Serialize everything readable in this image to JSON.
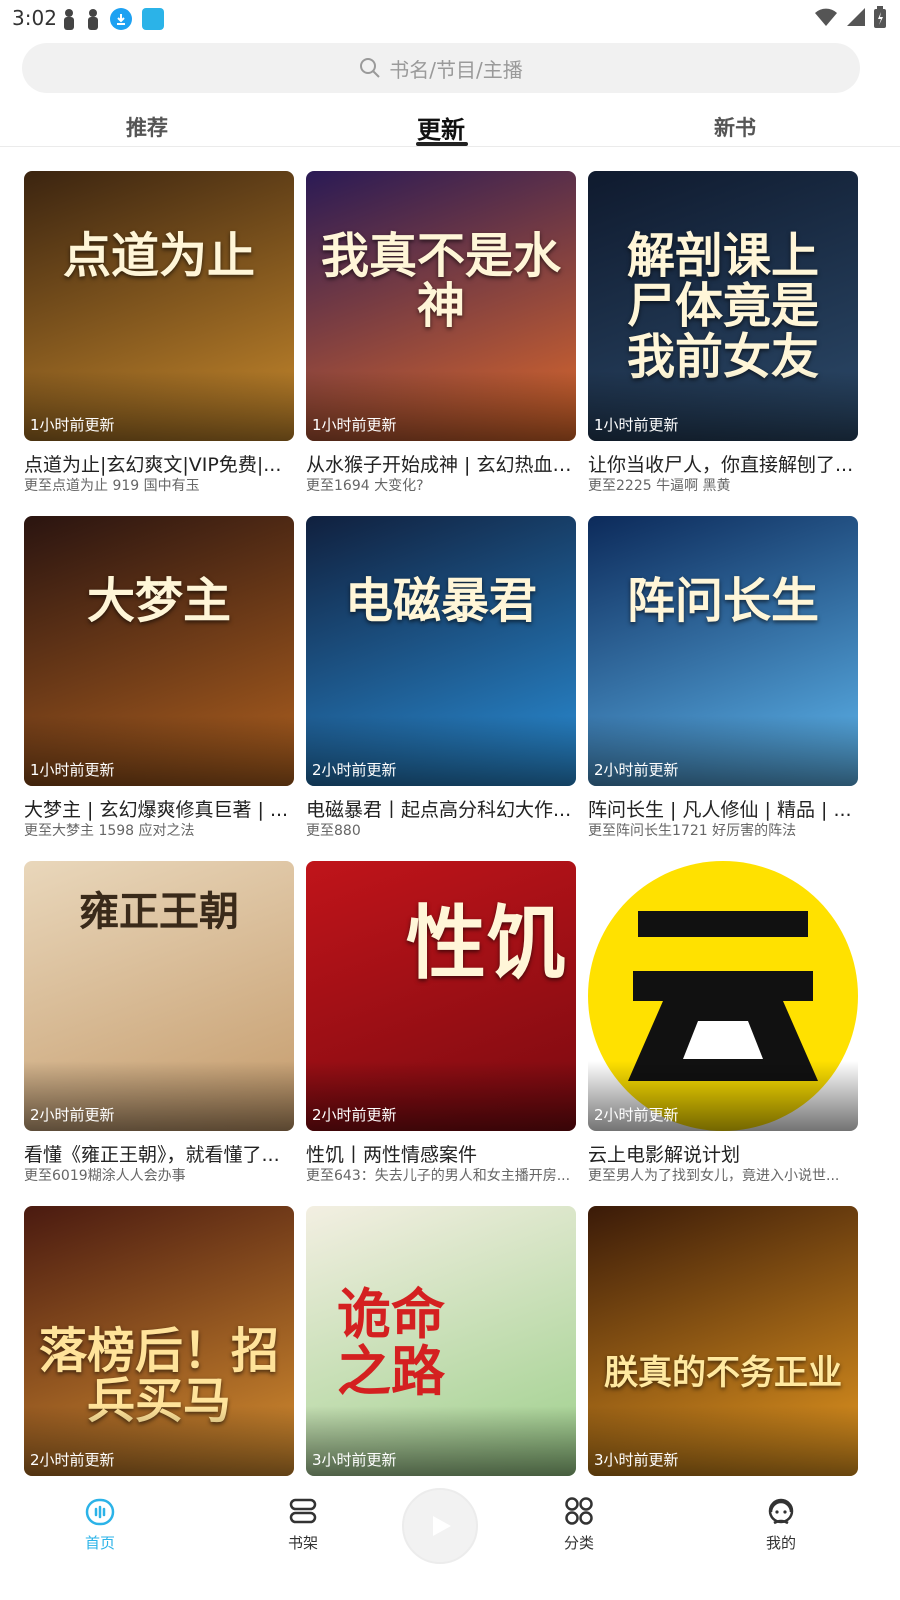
{
  "status": {
    "time": "3:02"
  },
  "search": {
    "placeholder": "书名/节目/主播"
  },
  "tabs": [
    {
      "label": "推荐"
    },
    {
      "label": "更新",
      "active": true
    },
    {
      "label": "新书"
    }
  ],
  "books": [
    {
      "cover_text": "点道为止",
      "update": "1小时前更新",
      "title": "点道为止|玄幻爽文|VIP免费|...",
      "subtitle": "更至点道为止 919 国中有玉",
      "colors": [
        "#3b2410",
        "#c98a2c"
      ]
    },
    {
      "cover_text": "我真不是水神",
      "update": "1小时前更新",
      "title": "从水猴子开始成神 | 玄幻热血 ...",
      "subtitle": "更至1694 大变化?",
      "colors": [
        "#2a1a55",
        "#e06a2a"
      ]
    },
    {
      "cover_text": "解剖课上 尸体竟是 我前女友",
      "update": "1小时前更新",
      "title": "让你当收尸人，你直接解刨了...",
      "subtitle": "更至2225 牛逼啊 黑黄",
      "colors": [
        "#0f1a2e",
        "#2c4a6a"
      ]
    },
    {
      "cover_text": "大梦主",
      "update": "1小时前更新",
      "title": "大梦主 | 玄幻爆爽修真巨著 | ...",
      "subtitle": "更至大梦主 1598 应对之法",
      "colors": [
        "#2a1410",
        "#b0611f"
      ]
    },
    {
      "cover_text": "电磁暴君",
      "update": "2小时前更新",
      "title": "电磁暴君丨起点高分科幻大作...",
      "subtitle": "更至880",
      "colors": [
        "#10203e",
        "#2a8fd8"
      ]
    },
    {
      "cover_text": "阵问长生",
      "update": "2小时前更新",
      "title": "阵问长生 | 凡人修仙 | 精品 | ...",
      "subtitle": "更至阵问长生1721 好厉害的阵法",
      "colors": [
        "#0c2a5a",
        "#5fb8f0"
      ]
    },
    {
      "cover_text": "雍正王朝",
      "update": "2小时前更新",
      "title": "看懂《雍正王朝》，就看懂了...",
      "subtitle": "更至6019糊涂人人会办事",
      "colors": [
        "#e9d7bb",
        "#c49a6a"
      ]
    },
    {
      "cover_text": "性饥",
      "update": "2小时前更新",
      "title": "性饥丨两性情感案件",
      "subtitle": "更至643：失去儿子的男人和女主播开房...",
      "colors": [
        "#c0141a",
        "#7a0a10"
      ]
    },
    {
      "cover_text": "云",
      "update": "2小时前更新",
      "title": "云上电影解说计划",
      "subtitle": "更至男人为了找到女儿，竟进入小说世...",
      "colors": [
        "#ffe100",
        "#ffe100"
      ]
    },
    {
      "cover_text": "落榜后！招兵买马",
      "update": "2小时前更新",
      "title": "",
      "subtitle": "",
      "colors": [
        "#4a1a10",
        "#d89030"
      ]
    },
    {
      "cover_text": "诡命之路",
      "update": "3小时前更新",
      "title": "",
      "subtitle": "",
      "colors": [
        "#f3efe2",
        "#9ccf8a"
      ]
    },
    {
      "cover_text": "朕真的不务正业",
      "update": "3小时前更新",
      "title": "",
      "subtitle": "",
      "colors": [
        "#3a1a08",
        "#e89a20"
      ]
    }
  ],
  "nav": [
    {
      "label": "首页",
      "icon": "home-icon",
      "active": true
    },
    {
      "label": "书架",
      "icon": "bookshelf-icon"
    },
    {
      "label": "分类",
      "icon": "category-icon"
    },
    {
      "label": "我的",
      "icon": "profile-icon"
    }
  ],
  "accent_color": "#2bb3e8"
}
